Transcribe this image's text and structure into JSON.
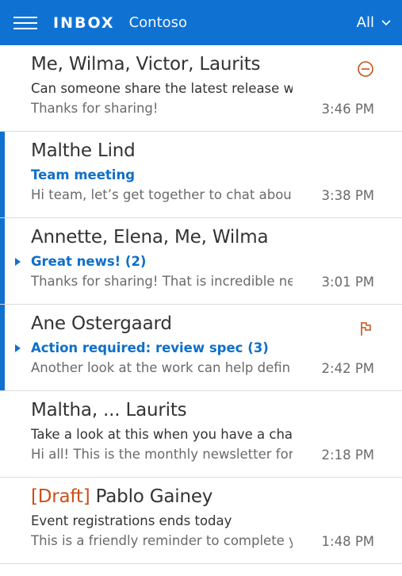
{
  "header": {
    "title": "INBOX",
    "account": "Contoso",
    "filter": "All",
    "menu_icon": "hamburger-menu-icon",
    "filter_icon": "chevron-down-icon",
    "background_color": "#0f72d3"
  },
  "colors": {
    "accent": "#1070d0",
    "draft": "#c9501a",
    "divider": "#dcdcdc"
  },
  "messages": [
    {
      "sender": "Me, Wilma, Victor, Laurits",
      "subject": "Can someone share the latest release w",
      "preview": "Thanks for sharing!",
      "time": "3:46 PM",
      "icon": "blocked-circle-icon"
    },
    {
      "sender": "Malthe Lind",
      "subject": "Team meeting",
      "preview": "Hi team, let’s get together to chat abou",
      "time": "3:38 PM"
    },
    {
      "sender": "Annette, Elena, Me, Wilma",
      "subject": "Great news! (2)",
      "preview": "Thanks for sharing! That is incredible ne",
      "time": "3:01 PM"
    },
    {
      "sender": "Ane Ostergaard",
      "subject": "Action required: review spec (3)",
      "preview": "Another look at the work can help defin",
      "time": "2:42 PM",
      "icon": "flag-icon"
    },
    {
      "sender": "Maltha, ... Laurits",
      "subject": "Take a look at this when you have a cha",
      "preview": "Hi all! This is the monthly newsletter for",
      "time": "2:18 PM"
    },
    {
      "draft_label": "[Draft]",
      "sender": "Pablo Gainey",
      "subject": "Event registrations ends today",
      "preview": "This is a friendly reminder to complete y",
      "time": "1:48 PM"
    }
  ]
}
